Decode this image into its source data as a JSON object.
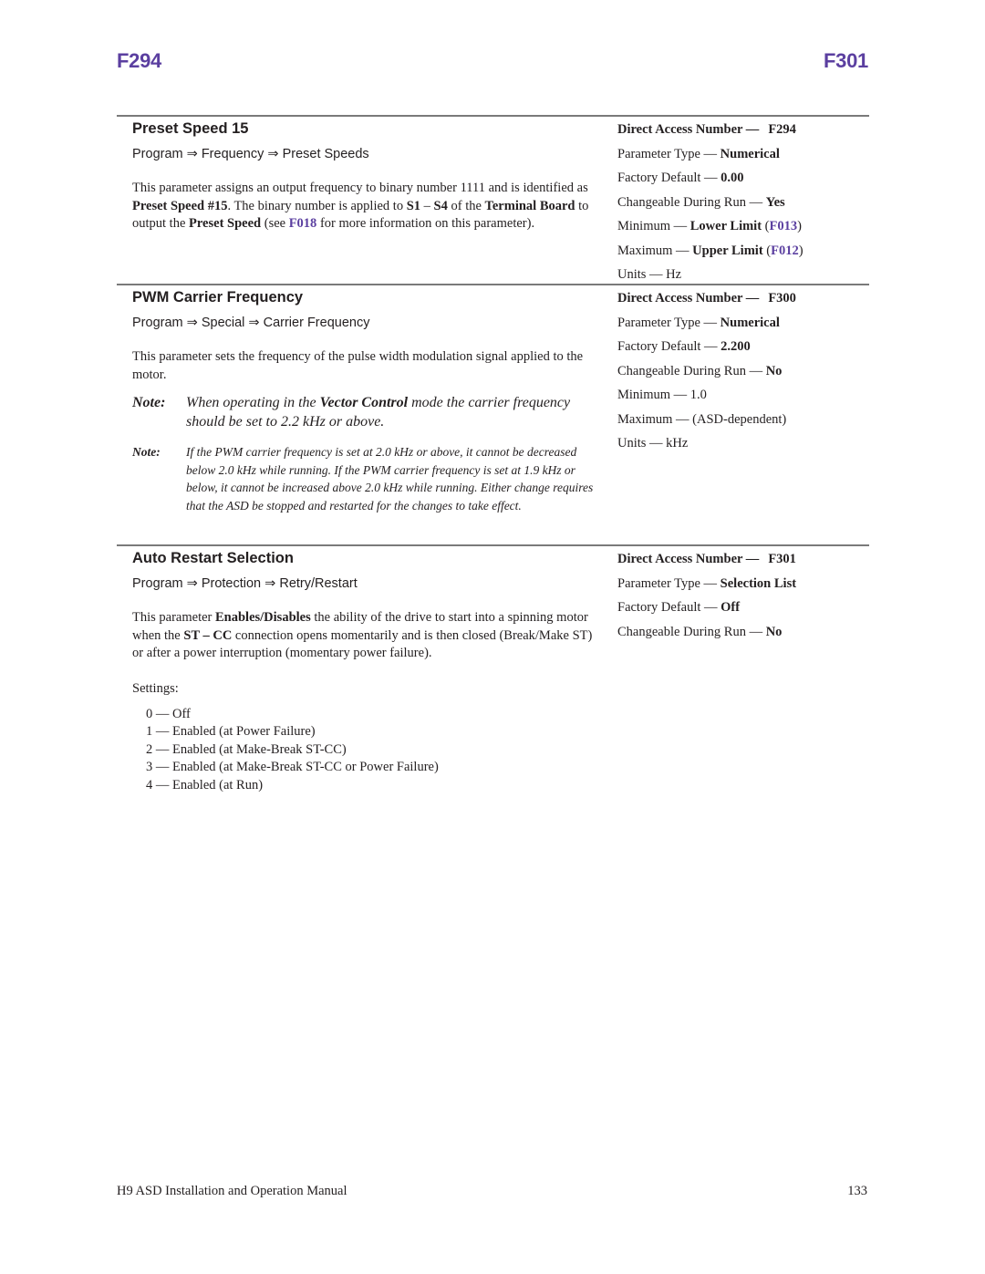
{
  "header": {
    "left_code": "F294",
    "right_code": "F301"
  },
  "sections": [
    {
      "title": "Preset Speed 15",
      "path": [
        "Program",
        "Frequency",
        "Preset Speeds"
      ],
      "description": {
        "t1": "This parameter assigns an output frequency to binary number 1111 and is identified as ",
        "b1": "Preset Speed #15",
        "t2": ". The binary number is applied to ",
        "b2": "S1",
        "t3": " – ",
        "b3": "S4",
        "t4": " of the ",
        "b4": "Terminal Board",
        "t5": " to output the ",
        "b5": "Preset Speed",
        "t6": " (see ",
        "link": "F018",
        "t7": " for more information on this parameter)."
      },
      "properties": {
        "direct_access_label": "Direct Access Number —",
        "direct_access_value": "F294",
        "parameter_type_label": "Parameter Type — ",
        "parameter_type_value": "Numerical",
        "factory_default_label": "Factory Default — ",
        "factory_default_value": "0.00",
        "changeable_label": "Changeable During Run — ",
        "changeable_value": "Yes",
        "minimum_label": "Minimum — ",
        "minimum_value": "Lower Limit",
        "minimum_link": "F013",
        "maximum_label": "Maximum — ",
        "maximum_value": "Upper Limit",
        "maximum_link": "F012",
        "units": "Units — Hz"
      }
    },
    {
      "title": "PWM Carrier Frequency",
      "path": [
        "Program",
        "Special",
        "Carrier Frequency"
      ],
      "description": "This parameter sets the frequency of the pulse width modulation signal applied to the motor.",
      "note1": {
        "label": "Note:",
        "t1": "When operating in the ",
        "b1": "Vector Control",
        "t2": " mode the carrier frequency should be set to 2.2 kHz or above."
      },
      "note2": {
        "label": "Note:",
        "text": "If the PWM carrier frequency is set at 2.0 kHz or above, it cannot be decreased below 2.0 kHz while running. If the PWM carrier frequency is set at 1.9 kHz or below, it cannot be increased above 2.0 kHz while running. Either change requires that the ASD be stopped and restarted for the changes to take effect."
      },
      "properties": {
        "direct_access_label": "Direct Access Number —",
        "direct_access_value": "F300",
        "parameter_type_label": "Parameter Type — ",
        "parameter_type_value": "Numerical",
        "factory_default_label": "Factory Default — ",
        "factory_default_value": "2.200",
        "changeable_label": "Changeable During Run — ",
        "changeable_value": "No",
        "minimum": "Minimum — 1.0",
        "maximum": "Maximum — (ASD-dependent)",
        "units": "Units — kHz"
      }
    },
    {
      "title": "Auto Restart Selection",
      "path": [
        "Program",
        "Protection",
        "Retry/Restart"
      ],
      "description": {
        "t1": "This parameter ",
        "b1": "Enables/Disables",
        "t2": " the ability of the drive to start into a spinning motor when the ",
        "b2": "ST – CC",
        "t3": " connection opens momentarily and is then closed (Break/Make ST) or after a power interruption (momentary power failure)."
      },
      "settings_label": "Settings:",
      "settings": [
        "0 — Off",
        "1 — Enabled (at Power Failure)",
        "2 — Enabled (at Make-Break ST-CC)",
        "3 — Enabled (at Make-Break ST-CC or Power Failure)",
        "4 — Enabled (at Run)"
      ],
      "properties": {
        "direct_access_label": "Direct Access Number —",
        "direct_access_value": "F301",
        "parameter_type_label": "Parameter Type — ",
        "parameter_type_value": "Selection List",
        "factory_default_label": "Factory Default — ",
        "factory_default_value": "Off",
        "changeable_label": "Changeable During Run — ",
        "changeable_value": "No"
      }
    }
  ],
  "path_separator": " ⇒ ",
  "footer": {
    "manual_title": "H9 ASD Installation and Operation Manual",
    "page_number": "133"
  }
}
